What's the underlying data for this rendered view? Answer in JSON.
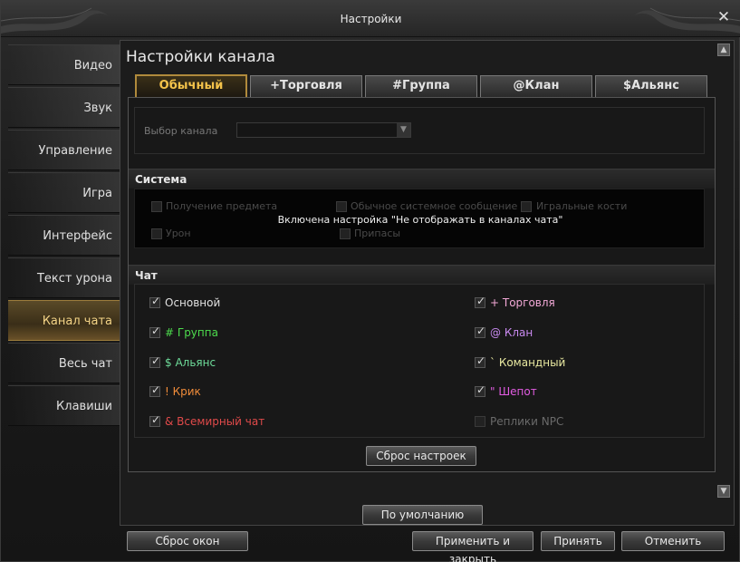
{
  "window": {
    "title": "Настройки",
    "close_label": "✕"
  },
  "sidebar": {
    "items": [
      {
        "label": "Видео"
      },
      {
        "label": "Звук"
      },
      {
        "label": "Управление"
      },
      {
        "label": "Игра"
      },
      {
        "label": "Интерфейс"
      },
      {
        "label": "Текст урона"
      },
      {
        "label": "Канал чата",
        "active": true
      },
      {
        "label": "Весь чат"
      },
      {
        "label": "Клавиши"
      }
    ]
  },
  "main": {
    "title": "Настройки канала",
    "tabs": [
      {
        "label": "Обычный",
        "active": true
      },
      {
        "label": "+Торговля"
      },
      {
        "label": "#Группа"
      },
      {
        "label": "@Клан"
      },
      {
        "label": "$Альянс"
      }
    ],
    "channel": {
      "label": "Выбор канала",
      "value": ""
    },
    "system": {
      "heading": "Система",
      "items": [
        "Получение предмета",
        "Обычное системное сообщение",
        "Игральные кости",
        "Урон",
        "Припасы"
      ],
      "overlay": "Включена настройка \"Не отображать в каналах чата\""
    },
    "chat": {
      "heading": "Чат",
      "items": [
        {
          "label": "Основной",
          "color": "#e0e0e0",
          "checked": true
        },
        {
          "label": "+ Торговля",
          "color": "#f2a8d6",
          "checked": true
        },
        {
          "label": "# Группа",
          "color": "#4ddc4d",
          "checked": true
        },
        {
          "label": "@ Клан",
          "color": "#c98af0",
          "checked": true
        },
        {
          "label": "$ Альянс",
          "color": "#6edc9a",
          "checked": true
        },
        {
          "label": "` Командный",
          "color": "#e8e8a0",
          "checked": true
        },
        {
          "label": "! Крик",
          "color": "#f08c3a",
          "checked": true
        },
        {
          "label": "\" Шепот",
          "color": "#e25ce2",
          "checked": true
        },
        {
          "label": "& Всемирный чат",
          "color": "#e04a4a",
          "checked": true
        },
        {
          "label": "Реплики NPC",
          "color": "#6a6a6a",
          "checked": false
        }
      ],
      "reset_label": "Сброс настроек"
    },
    "default_label": "По умолчанию"
  },
  "footer": {
    "reset_windows": "Сброс окон",
    "apply_close": "Применить и закрыть",
    "apply": "Принять",
    "cancel": "Отменить"
  }
}
